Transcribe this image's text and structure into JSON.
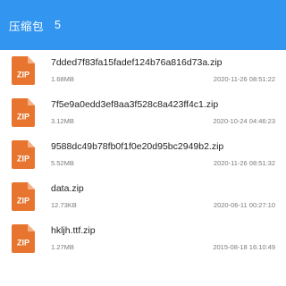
{
  "header": {
    "title": "压缩包",
    "count": "5"
  },
  "colors": {
    "header_bg": "#3296f0",
    "zip_icon": "#e8752f"
  },
  "file_icon": "zip-file-icon",
  "files": [
    {
      "name": "7dded7f83fa15fadef124b76a816d73a.zip",
      "size": "1.68MB",
      "date": "2020-11-26 08:51:22",
      "badge": "ZIP"
    },
    {
      "name": "7f5e9a0edd3ef8aa3f528c8a423ff4c1.zip",
      "size": "3.12MB",
      "date": "2020-10-24 04:46:23",
      "badge": "ZIP"
    },
    {
      "name": "9588dc49b78fb0f1f0e20d95bc2949b2.zip",
      "size": "5.52MB",
      "date": "2020-11-26 08:51:32",
      "badge": "ZIP"
    },
    {
      "name": "data.zip",
      "size": "12.73KB",
      "date": "2020-06-11 00:27:10",
      "badge": "ZIP"
    },
    {
      "name": "hkljh.ttf.zip",
      "size": "1.27MB",
      "date": "2015-08-18 16:10:49",
      "badge": "ZIP"
    }
  ]
}
